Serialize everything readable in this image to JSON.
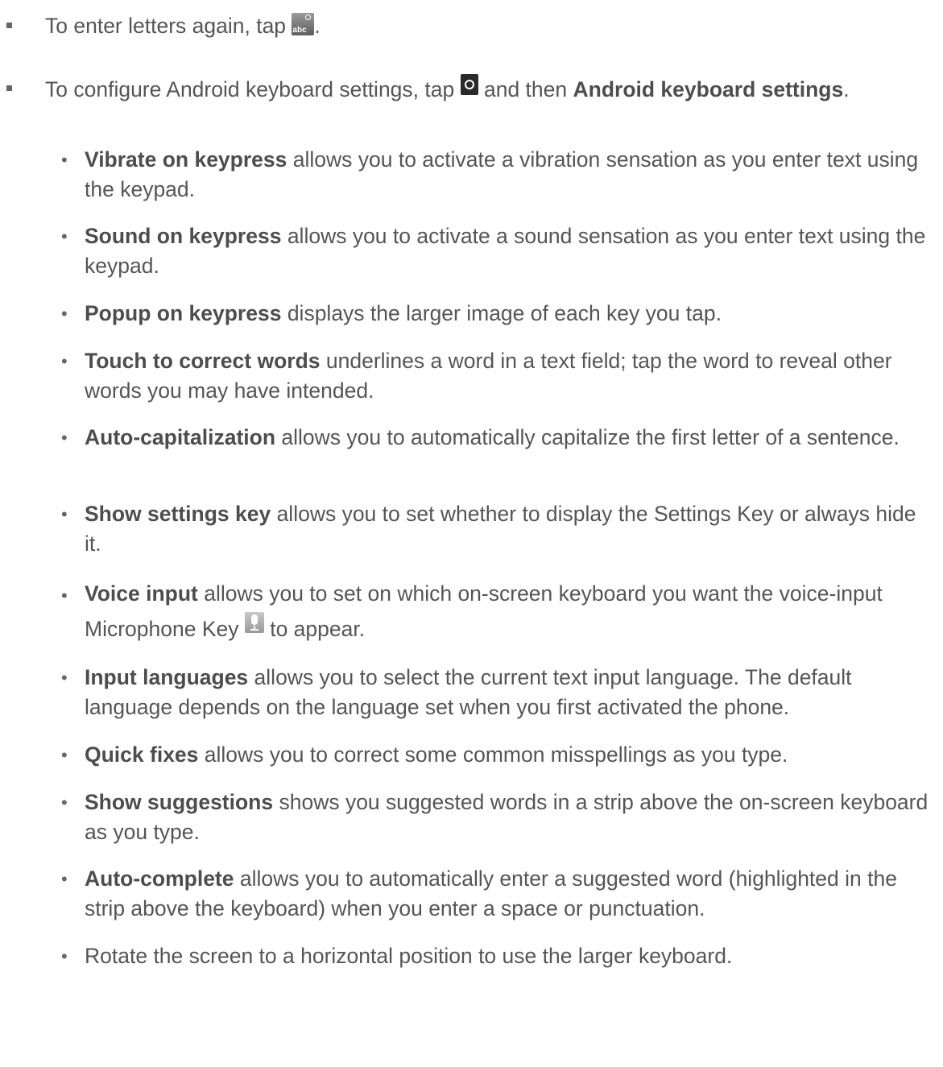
{
  "items": [
    {
      "lead": "",
      "bold": "",
      "text": "To enter letters again, tap ",
      "icon": "abc-keyboard-icon",
      "after": "."
    },
    {
      "lead": "To configure Android keyboard settings, tap ",
      "icon": "settings-key-icon",
      "middle": " and then ",
      "bold": "Android keyboard settings",
      "after": "."
    },
    {
      "bold": "Vibrate on keypress",
      "text": " allows you to activate a vibration sensation as you enter text using the keypad."
    },
    {
      "bold": "Sound on keypress",
      "text": " allows you to activate a sound sensation as you enter text using the keypad."
    },
    {
      "bold": "Popup on keypress",
      "text": " displays the larger image of each key you tap."
    },
    {
      "bold": "Touch to correct words",
      "text": " underlines a word in a text field; tap the word to reveal other words you may have intended."
    },
    {
      "bold": "Auto-capitalization",
      "text": " allows you to automatically capitalize the first letter of a sentence."
    },
    {
      "bold": "Show settings key",
      "text": " allows you to set whether to display the Settings Key or always hide it."
    },
    {
      "bold": "Voice input",
      "text": " allows you to set on which on-screen keyboard you want the voice-input Microphone Key ",
      "icon": "microphone-key-icon",
      "after": " to appear."
    },
    {
      "bold": "Input languages",
      "text": " allows you to select the current text input language. The default language depends on the language set when you first activated the phone."
    },
    {
      "bold": "Quick fixes",
      "text": " allows you to correct some common misspellings as you type."
    },
    {
      "bold": "Show suggestions",
      "text": " shows you suggested words in a strip above the on-screen keyboard as you type."
    },
    {
      "bold": "Auto-complete",
      "text": " allows you to automatically enter a suggested word (highlighted in the strip above the keyboard) when you enter a space or punctuation."
    },
    {
      "bold": "",
      "text": "Rotate the screen to a horizontal position to use the larger keyboard."
    }
  ],
  "icons": {
    "abc_key_label": "abc"
  }
}
